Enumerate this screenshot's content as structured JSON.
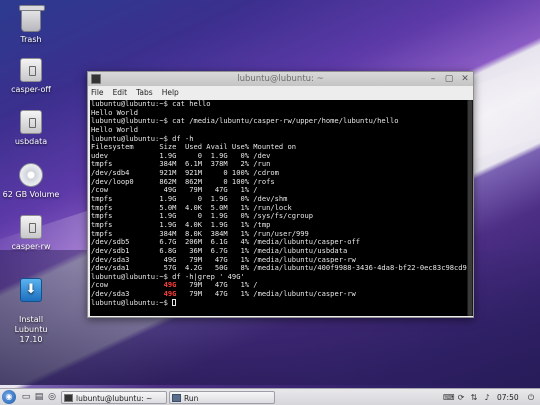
{
  "desktop": {
    "icons": [
      {
        "label": "Trash",
        "icon": "trash-icon"
      },
      {
        "label": "casper-off",
        "icon": "usb-drive-icon"
      },
      {
        "label": "usbdata",
        "icon": "usb-drive-icon"
      },
      {
        "label": "62 GB Volume",
        "icon": "disk-volume-icon"
      },
      {
        "label": "casper-rw",
        "icon": "usb-drive-icon"
      },
      {
        "label": "Install\nLubuntu 17.10",
        "icon": "install-icon"
      }
    ]
  },
  "terminal": {
    "title": "lubuntu@lubuntu: ~",
    "menu": [
      "File",
      "Edit",
      "Tabs",
      "Help"
    ],
    "lines": [
      "lubuntu@lubuntu:~$ cat hello",
      "Hello World",
      "lubuntu@lubuntu:~$ cat /media/lubuntu/casper-rw/upper/home/lubuntu/hello",
      "Hello World",
      "lubuntu@lubuntu:~$ df -h",
      "Filesystem      Size  Used Avail Use% Mounted on",
      "udev            1.9G     0  1.9G   0% /dev",
      "tmpfs           384M  6.1M  378M   2% /run",
      "/dev/sdb4       921M  921M     0 100% /cdrom",
      "/dev/loop0      862M  862M     0 100% /rofs",
      "/cow             49G   79M   47G   1% /",
      "tmpfs           1.9G     0  1.9G   0% /dev/shm",
      "tmpfs           5.0M  4.0K  5.0M   1% /run/lock",
      "tmpfs           1.9G     0  1.9G   0% /sys/fs/cgroup",
      "tmpfs           1.9G  4.0K  1.9G   1% /tmp",
      "tmpfs           384M  8.0K  384M   1% /run/user/999",
      "/dev/sdb5       6.7G  206M  6.1G   4% /media/lubuntu/casper-off",
      "/dev/sdb1       6.8G   36M  6.7G   1% /media/lubuntu/usbdata",
      "/dev/sda3        49G   79M   47G   1% /media/lubuntu/casper-rw",
      "/dev/sda1        57G  4.2G   50G   8% /media/lubuntu/400f9988-3436-4da8-bf22-0ec83c98cd95",
      "lubuntu@lubuntu:~$ df -h|grep ' 49G'",
      "/cow             49G   79M   47G   1% /",
      "/dev/sda3        49G   79M   47G   1% /media/lubuntu/casper-rw",
      "lubuntu@lubuntu:~$ "
    ],
    "highlight": "49G"
  },
  "taskbar": {
    "tasks": [
      {
        "label": "lubuntu@lubuntu: ~",
        "icon": "terminal-icon"
      },
      {
        "label": "Run",
        "icon": "run-icon"
      }
    ],
    "clock": "07:50"
  }
}
